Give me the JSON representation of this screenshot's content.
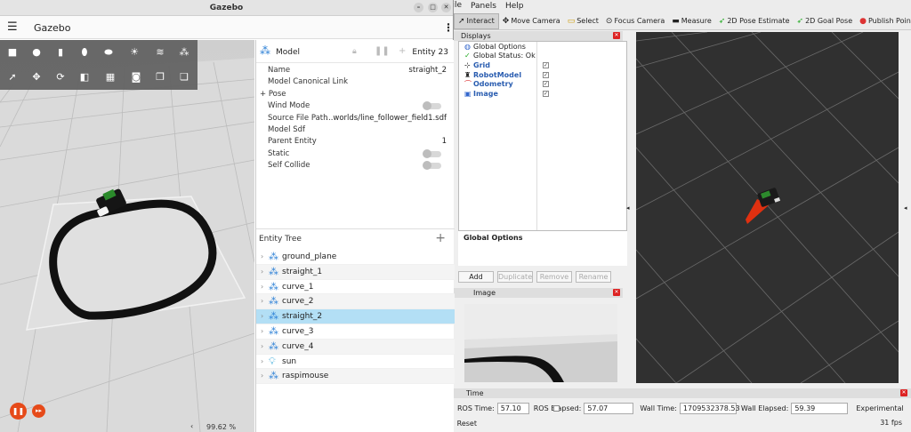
{
  "rviz": {
    "menu": [
      "File",
      "Panels",
      "Help"
    ],
    "toolbar": [
      {
        "label": "Interact",
        "icon": "interact-icon",
        "active": true
      },
      {
        "label": "Move Camera",
        "icon": "move-camera-icon"
      },
      {
        "label": "Select",
        "icon": "select-icon"
      },
      {
        "label": "Focus Camera",
        "icon": "focus-camera-icon"
      },
      {
        "label": "Measure",
        "icon": "measure-icon"
      },
      {
        "label": "2D Pose Estimate",
        "icon": "pose-estimate-icon"
      },
      {
        "label": "2D Goal Pose",
        "icon": "goal-pose-icon"
      },
      {
        "label": "Publish Point",
        "icon": "publish-point-icon"
      }
    ],
    "displays": {
      "title": "Displays",
      "rows": [
        {
          "label": "Global Options",
          "icon": "globe-icon"
        },
        {
          "label": "Global Status: Ok",
          "icon": "check-icon"
        },
        {
          "label": "Grid",
          "icon": "grid-icon",
          "checked": true
        },
        {
          "label": "RobotModel",
          "icon": "robot-model-icon",
          "checked": true
        },
        {
          "label": "Odometry",
          "icon": "odometry-icon",
          "checked": true
        },
        {
          "label": "Image",
          "icon": "image-icon",
          "checked": true
        }
      ],
      "description_title": "Global Options",
      "buttons": {
        "add": "Add",
        "duplicate": "Duplicate",
        "remove": "Remove",
        "rename": "Rename"
      }
    },
    "image_panel": {
      "title": "Image"
    },
    "time": {
      "title": "Time",
      "ros_time_label": "ROS Time:",
      "ros_time": "57.10",
      "ros_elapsed_label": "ROS Elapsed:",
      "ros_elapsed": "57.07",
      "wall_time_label": "Wall Time:",
      "wall_time": "1709532378.53",
      "wall_elapsed_label": "Wall Elapsed:",
      "wall_elapsed": "59.39",
      "experimental_label": "Experimental",
      "reset_label": "Reset",
      "fps": "31 fps"
    }
  },
  "gazebo": {
    "window_title": "Gazebo",
    "app_title": "Gazebo",
    "rtf": "99.62 %",
    "component": {
      "type": "Model",
      "entity": "Entity 23",
      "rows": [
        {
          "key": "Name",
          "value": "straight_2"
        },
        {
          "key": "Model Canonical Link",
          "value": ""
        },
        {
          "key": "+ Pose",
          "value": ""
        },
        {
          "key": "Wind Mode",
          "value": "",
          "toggle": true
        },
        {
          "key": "Source File Path",
          "value": "...worlds/line_follower_field1.sdf"
        },
        {
          "key": "Model Sdf",
          "value": ""
        },
        {
          "key": "Parent Entity",
          "value": "1"
        },
        {
          "key": "Static",
          "value": "",
          "toggle": true
        },
        {
          "key": "Self Collide",
          "value": "",
          "toggle": true
        }
      ]
    },
    "entity_tree": {
      "title": "Entity Tree",
      "items": [
        {
          "name": "ground_plane",
          "icon": "model-icon"
        },
        {
          "name": "straight_1",
          "icon": "model-icon"
        },
        {
          "name": "curve_1",
          "icon": "model-icon"
        },
        {
          "name": "curve_2",
          "icon": "model-icon"
        },
        {
          "name": "straight_2",
          "icon": "model-icon",
          "selected": true
        },
        {
          "name": "curve_3",
          "icon": "model-icon"
        },
        {
          "name": "curve_4",
          "icon": "model-icon"
        },
        {
          "name": "sun",
          "icon": "light-bulb-icon"
        },
        {
          "name": "raspimouse",
          "icon": "model-icon"
        }
      ]
    }
  }
}
